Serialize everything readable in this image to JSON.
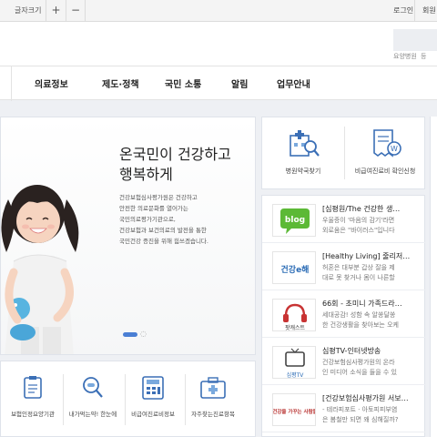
{
  "topbar": {
    "font_size_label": "글자크기",
    "zoom_in": "+",
    "zoom_out": "−",
    "login": "로그인",
    "member": "회원"
  },
  "header": {
    "sitemap_link": "요양병원",
    "etc_link": "등"
  },
  "nav": {
    "items": [
      "의료정보",
      "제도·정책",
      "국민 소통",
      "알림",
      "업무안내"
    ]
  },
  "banner": {
    "headline_1": "온국민이 건강하고",
    "headline_2": "행복하게",
    "desc": [
      "건강보험심사평가원은 건강하고",
      "안전한 의료문화를 열어가는",
      "국민의료평가기관으로,",
      "건강보험과 보건의료의 발전을 통한",
      "국민건강 증진을 위해 힘쓰겠습니다."
    ],
    "pager_control": "◌"
  },
  "quick_menu": [
    {
      "label": "요양기관",
      "icon": "clipboard-icon",
      "cropped_prefix": "보험인정"
    },
    {
      "label": "내가먹는약! 한눈에",
      "icon": "magnifier-pill-icon"
    },
    {
      "label": "비급여진료비정보",
      "icon": "calculator-icon"
    },
    {
      "label": "자주찾는진료항목",
      "icon": "medical-kit-icon"
    }
  ],
  "services": [
    {
      "label": "병원약국찾기",
      "icon": "hospital-search-icon"
    },
    {
      "label": "비급여진료비 확인신청",
      "icon": "receipt-won-icon"
    }
  ],
  "sns": [
    {
      "thumb": "blog",
      "title": "[심평원/The 건강한 생…",
      "lines": [
        "우울증이 '마음의 감기'라면",
        "외로움은 \"바이러스\"입니다"
      ]
    },
    {
      "thumb": "건강e해",
      "title": "[Healthy Living] 줄리저…",
      "lines": [
        "허혼은 대부분 갑상 잘을 제",
        "대로 못 찾거나 몸이 나른할"
      ]
    },
    {
      "thumb": "팟캐스트",
      "title": "66회 - 초미니 가족드라…",
      "lines": [
        "세대공감! 성함 속 알쏭달쏭",
        "한 건강생활을 찾아보는 오케"
      ]
    },
    {
      "thumb": "심평TV",
      "title": "심평TV-인터넷방송",
      "lines": [
        "건강보험심사평가원의 온라",
        "인 미디어 소식을 들을 수 있"
      ]
    },
    {
      "thumb": "건강을 가꾸는 사람들",
      "title": "[건강보험심사평가원 서보…",
      "lines": [
        "- 테라피포트 · 아토피피부염",
        "은 봄철만 되면 왜 심해질까?"
      ]
    }
  ],
  "colors": {
    "accent_blue": "#4a7fd4",
    "icon_blue": "#3b6fb6",
    "nav_text": "#222222"
  }
}
